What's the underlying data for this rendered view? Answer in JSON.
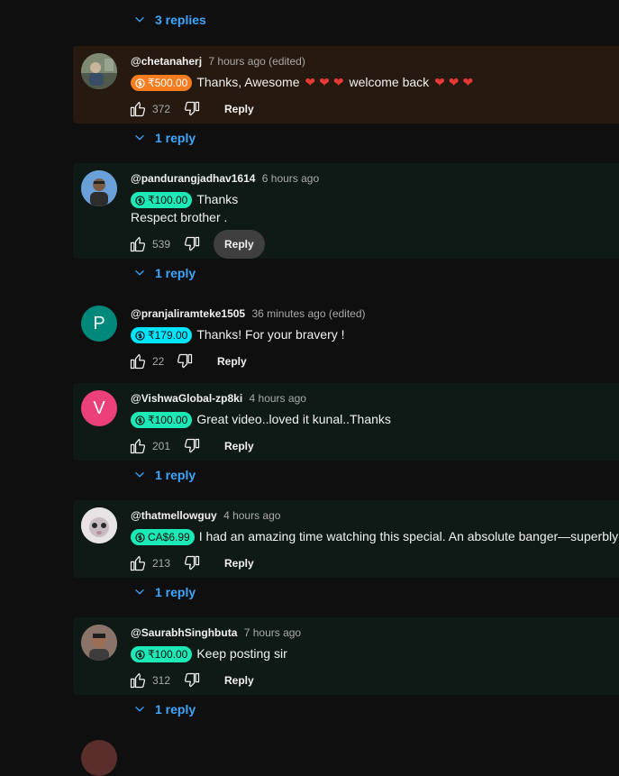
{
  "toggles": {
    "t0": "3 replies",
    "t1": "1 reply",
    "t2": "1 reply",
    "t3": "1 reply",
    "t4": "1 reply",
    "t5": "1 reply"
  },
  "reply_label": "Reply",
  "comments": [
    {
      "author": "@chetanaherj",
      "time": "7 hours ago (edited)",
      "chip": "₹500.00",
      "text": "Thanks, Awesome",
      "text_after_hearts": "welcome back",
      "likes": "372",
      "avatar_icon": "profile-photo"
    },
    {
      "author": "@pandurangjadhav1614",
      "time": "6 hours ago",
      "chip": "₹100.00",
      "text": "Thanks",
      "text2": "Respect brother .",
      "likes": "539",
      "avatar_icon": "profile-photo"
    },
    {
      "author": "@pranjaliramteke1505",
      "time": "36 minutes ago (edited)",
      "chip": "₹179.00",
      "text": "Thanks! For your bravery !",
      "likes": "22",
      "avatar_letter": "P",
      "avatar_color": "#00897b"
    },
    {
      "author": "@VishwaGlobal-zp8ki",
      "time": "4 hours ago",
      "chip": "₹100.00",
      "text": "Great video..loved it kunal..Thanks",
      "likes": "201",
      "avatar_letter": "V",
      "avatar_color": "#ec407a"
    },
    {
      "author": "@thatmellowguy",
      "time": "4 hours ago",
      "chip": "CA$6.99",
      "text": "I had an amazing time watching this special. An absolute banger—superbly",
      "likes": "213",
      "avatar_icon": "profile-photo"
    },
    {
      "author": "@SaurabhSinghbuta",
      "time": "7 hours ago",
      "chip": "₹100.00",
      "text": "Keep posting sir",
      "likes": "312",
      "avatar_icon": "profile-photo"
    }
  ],
  "colors": {
    "background": "#0f0f0f",
    "link": "#3ea6ff",
    "chip_orange": "#f57c1f",
    "chip_green": "#1de9b6",
    "chip_cyan": "#00e5ff",
    "heart": "#e53935"
  }
}
